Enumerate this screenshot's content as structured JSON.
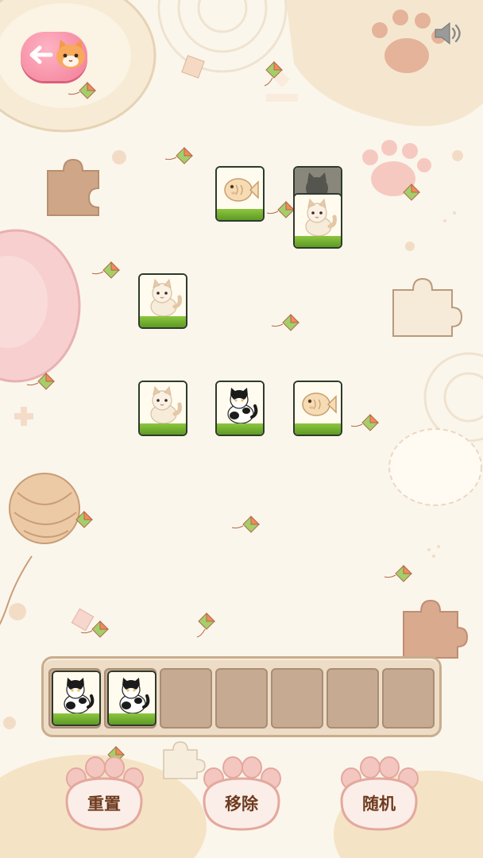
{
  "game": {
    "top_bar": {
      "back_icon": "back-arrow-icon",
      "sound_icon": "speaker-icon"
    },
    "board_tiles": [
      {
        "id": "fish-1",
        "kind": "fish",
        "covered": false
      },
      {
        "id": "cat-covered",
        "kind": "cat",
        "covered": true
      },
      {
        "id": "cat-fluffy-1",
        "kind": "fluffy-cat",
        "covered": false
      },
      {
        "id": "cat-fluffy-2",
        "kind": "fluffy-cat",
        "covered": false
      },
      {
        "id": "cat-fluffy-3",
        "kind": "fluffy-cat",
        "covered": false
      },
      {
        "id": "cat-spotted-1",
        "kind": "spotted-cat",
        "covered": false
      },
      {
        "id": "fish-2",
        "kind": "fish",
        "covered": false
      }
    ],
    "tray": {
      "slot_count": 7,
      "filled": [
        {
          "kind": "spotted-cat"
        },
        {
          "kind": "spotted-cat"
        }
      ]
    },
    "buttons": {
      "reset": "重置",
      "remove": "移除",
      "shuffle": "随机"
    }
  },
  "colors": {
    "background": "#fbf6ec",
    "tile_base": "#6aa82e",
    "button_text": "#6e3b1f",
    "back_button": "#f27d98"
  }
}
